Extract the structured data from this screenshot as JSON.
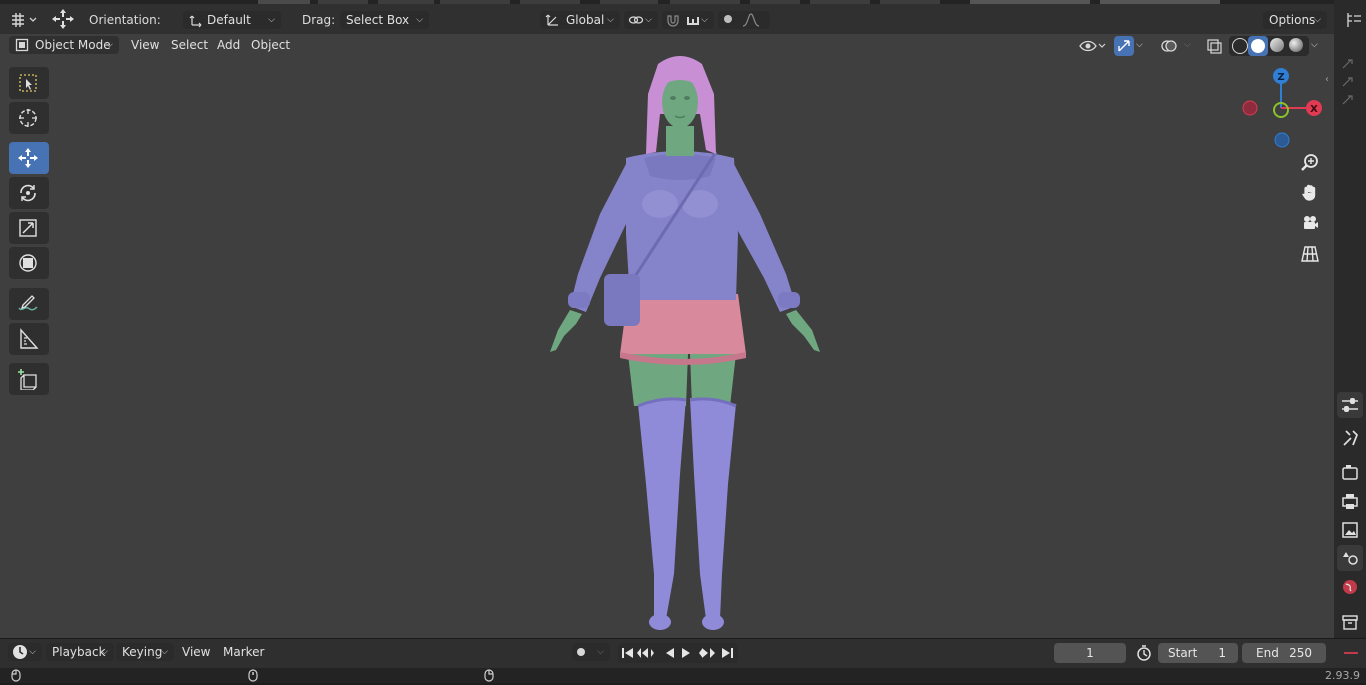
{
  "topbar": {
    "orientation_label": "Orientation:",
    "orientation_value": "Default",
    "drag_label": "Drag:",
    "drag_value": "Select Box",
    "transform_space": "Global",
    "options_label": "Options"
  },
  "header": {
    "mode": "Object Mode",
    "menus": [
      "View",
      "Select",
      "Add",
      "Object"
    ]
  },
  "gizmo": {
    "z_label": "Z",
    "x_label": "X",
    "colors": {
      "x": "#e13a52",
      "y": "#8bc22c",
      "z": "#2f7fd6"
    }
  },
  "toolbar": {
    "tools": [
      "select-box",
      "cursor",
      "move",
      "rotate",
      "scale",
      "transform",
      "annotate",
      "measure",
      "add-cube"
    ],
    "active_tool": "move"
  },
  "timeline": {
    "menus": [
      "Playback",
      "Keying",
      "View",
      "Marker"
    ],
    "current_frame": "1",
    "start_label": "Start",
    "start_value": "1",
    "end_label": "End",
    "end_value": "250"
  },
  "status": {
    "version": "2.93.9"
  },
  "colors": {
    "accent": "#4772b3",
    "viewport_bg": "#3f3f3f",
    "hair": "#c98fd4",
    "skin": "#6fa880",
    "sweater": "#8583c9",
    "skirt": "#d9899c",
    "stockings": "#8f8bd8"
  }
}
